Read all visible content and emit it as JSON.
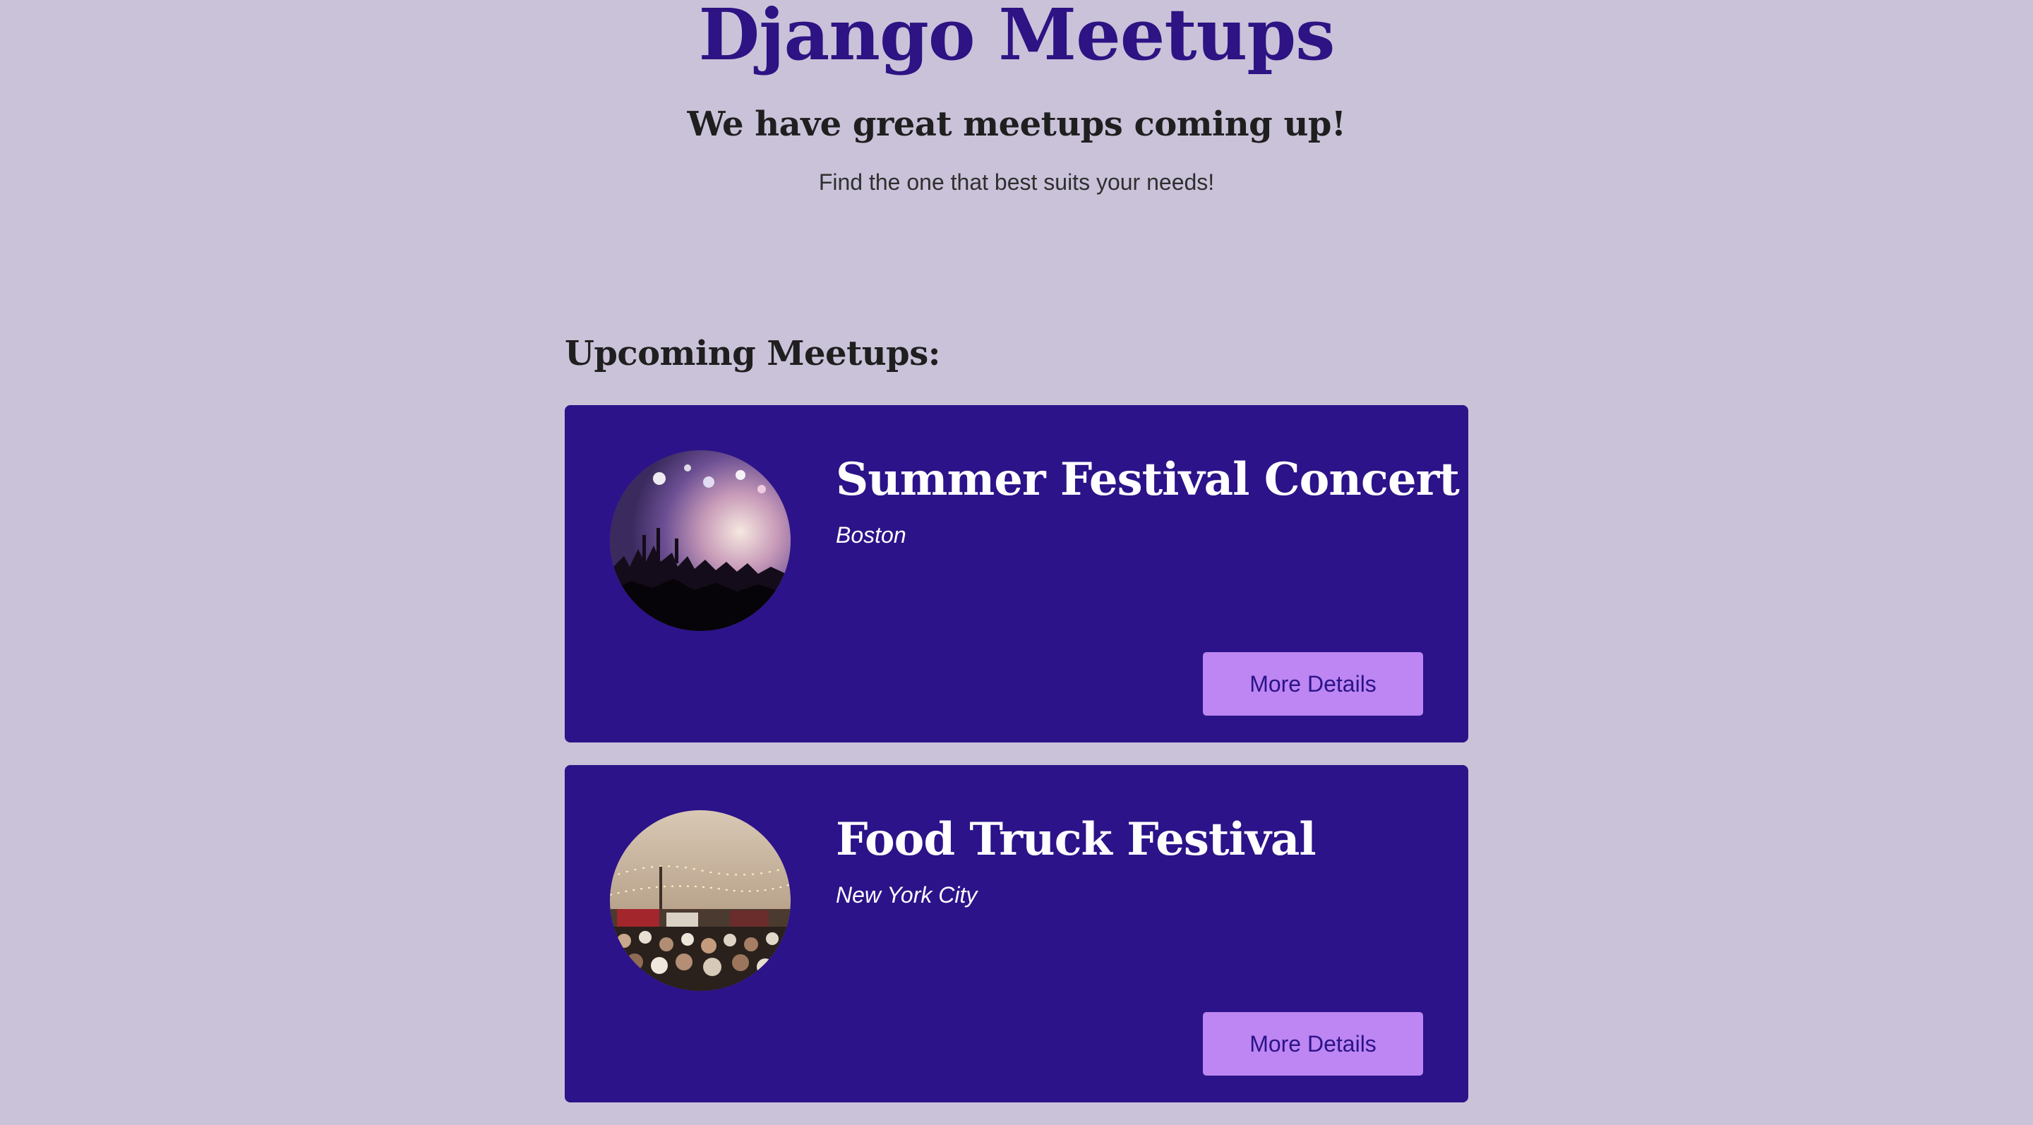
{
  "header": {
    "title": "Django Meetups",
    "tagline": "We have great meetups coming up!",
    "subtagline": "Find the one that best suits your needs!"
  },
  "main": {
    "section_heading": "Upcoming Meetups:",
    "meetups": [
      {
        "title": "Summer Festival Concert",
        "location": "Boston",
        "button_label": "More Details",
        "image": "concert-crowd-image"
      },
      {
        "title": "Food Truck Festival",
        "location": "New York City",
        "button_label": "More Details",
        "image": "food-truck-crowd-image"
      }
    ]
  },
  "colors": {
    "page_background": "#cac2d9",
    "title": "#2d1383",
    "card_background": "#2c1389",
    "button_background": "#bd86f2",
    "button_text": "#2c1389"
  }
}
